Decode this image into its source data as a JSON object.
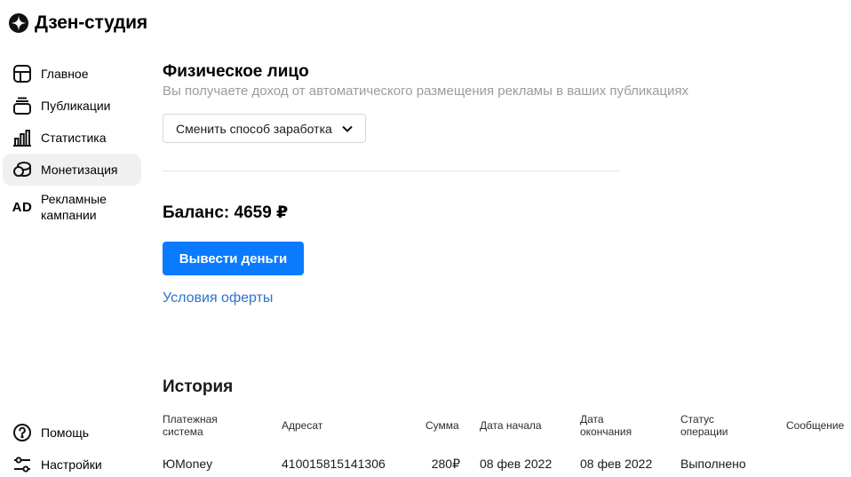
{
  "app": {
    "title": "Дзен-студия"
  },
  "sidebar": {
    "items": [
      {
        "label": "Главное",
        "icon": "home-layout-icon"
      },
      {
        "label": "Публикации",
        "icon": "publications-stack-icon"
      },
      {
        "label": "Статистика",
        "icon": "bar-chart-icon"
      },
      {
        "label": "Монетизация",
        "icon": "coins-icon",
        "active": true
      },
      {
        "label": "Рекламные кампании",
        "icon": "ad-icon",
        "icon_text": "AD"
      }
    ],
    "bottom_items": [
      {
        "label": "Помощь",
        "icon": "help-circle-icon"
      },
      {
        "label": "Настройки",
        "icon": "settings-sliders-icon"
      }
    ]
  },
  "main": {
    "title": "Физическое лицо",
    "subtitle": "Вы получаете доход от автоматического размещения рекламы в ваших публикациях",
    "method_button": "Сменить способ заработка",
    "balance": "Баланс: 4659 ₽",
    "withdraw_button": "Вывести деньги",
    "offer_link": "Условия оферты",
    "history_title": "История"
  },
  "history_table": {
    "headers": {
      "system": "Платежная система",
      "recipient": "Адресат",
      "amount": "Сумма",
      "start": "Дата начала",
      "end": "Дата окончания",
      "status": "Статус операции",
      "message": "Сообщение"
    },
    "rows": [
      {
        "system": "ЮMoney",
        "recipient": "410015815141306",
        "amount": "280₽",
        "start": "08 фев 2022",
        "end": "08 фев 2022",
        "status": "Выполнено",
        "message": ""
      }
    ]
  },
  "colors": {
    "accent": "#0a7bff",
    "link": "#2b74c9",
    "active_bg": "#f0f0f2",
    "muted_text": "#9a9ca0"
  }
}
